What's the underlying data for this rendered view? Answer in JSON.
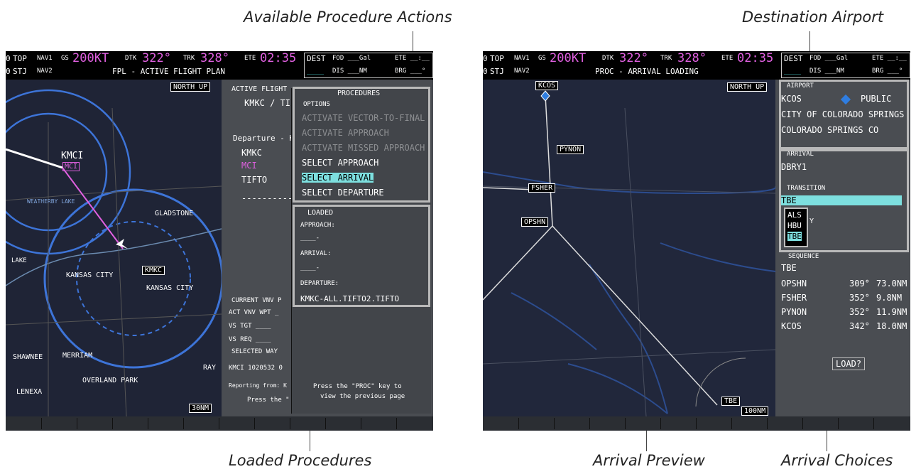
{
  "callouts": {
    "available_actions": "Available Procedure Actions",
    "destination_airport": "Destination Airport",
    "loaded_procedures": "Loaded Procedures",
    "arrival_preview": "Arrival Preview",
    "arrival_choices": "Arrival Choices"
  },
  "left": {
    "nav": {
      "top": "TOP",
      "stj": "STJ",
      "nav1": "NAV1",
      "nav2": "NAV2",
      "gs_label": "GS",
      "gs_value": "200KT",
      "dtk_label": "DTK",
      "dtk_value": "322°",
      "trk_label": "TRK",
      "trk_value": "328°",
      "ete_label": "ETE",
      "ete_value": "02:35",
      "dest": "DEST",
      "fod": "FOD ___Gal",
      "ete2": "ETE __:__",
      "dis": "DIS ___NM",
      "brg": "BRG ___°",
      "dashes": "____",
      "zero1": "0",
      "zero2": "0"
    },
    "page_title": "FPL - ACTIVE FLIGHT PLAN",
    "north_up": "NORTH UP",
    "range": "30NM",
    "map_labels": {
      "kmci": "KMCI",
      "mci": "MCI",
      "kmkc": "KMKC",
      "kansas_city": "KANSAS CITY",
      "kansas_city2": "KANSAS CITY",
      "gladstone": "GLADSTONE",
      "shawnee": "SHAWNEE",
      "merriam": "MERRIAM",
      "overland_park": "OVERLAND PARK",
      "lenexa": "LENEXA",
      "weatherby": "WEATHERBY LAKE",
      "rays": "RAY",
      "lake": "LAKE"
    },
    "fpl": {
      "active_flight": "ACTIVE FLIGHT",
      "route": "KMKC / TI",
      "departure": "Departure - K",
      "wp1": "KMKC",
      "wp2": "MCI",
      "wp3": "TIFTO",
      "dashes": "------------",
      "vnv_header": "CURRENT VNV P",
      "act_vnv": "ACT VNV WPT _",
      "vs_tgt": "VS TGT ____",
      "vs_req": "VS REQ ____",
      "selected": "SELECTED WAY",
      "kmci_coord": "KMCI 1020532 0",
      "reporting": "Reporting from: K",
      "press": "Press the \""
    },
    "procedures": {
      "header": "PROCEDURES",
      "options": "OPTIONS",
      "items": [
        {
          "label": "ACTIVATE VECTOR-TO-FINAL",
          "enabled": false
        },
        {
          "label": "ACTIVATE APPROACH",
          "enabled": false
        },
        {
          "label": "ACTIVATE MISSED APPROACH",
          "enabled": false
        },
        {
          "label": "SELECT APPROACH",
          "enabled": true
        },
        {
          "label": "SELECT ARRIVAL",
          "enabled": true,
          "selected": true
        },
        {
          "label": "SELECT DEPARTURE",
          "enabled": true
        }
      ]
    },
    "loaded": {
      "header": "LOADED",
      "approach_label": "APPROACH:",
      "approach_value": "____-",
      "arrival_label": "ARRIVAL:",
      "arrival_value": "____-",
      "departure_label": "DEPARTURE:",
      "departure_value": "KMKC-ALL.TIFTO2.TIFTO",
      "hint_line1": "Press the \"PROC\" key to",
      "hint_line2": "view the previous page"
    }
  },
  "right": {
    "nav": {
      "top": "TOP",
      "stj": "STJ",
      "nav1": "NAV1",
      "nav2": "NAV2",
      "gs_label": "GS",
      "gs_value": "200KT",
      "dtk_label": "DTK",
      "dtk_value": "322°",
      "trk_label": "TRK",
      "trk_value": "328°",
      "ete_label": "ETE",
      "ete_value": "02:35",
      "dest": "DEST",
      "fod": "FOD ___Gal",
      "ete2": "ETE __:__",
      "dis": "DIS ___NM",
      "brg": "BRG ___°",
      "dashes": "____",
      "zero1": "0",
      "zero2": "0"
    },
    "page_title": "PROC - ARRIVAL LOADING",
    "north_up": "NORTH UP",
    "range": "100NM",
    "waypoints": {
      "kcos": "KCOS",
      "pynon": "PYNON",
      "fsher": "FSHER",
      "opshn": "OPSHN",
      "tbe": "TBE"
    },
    "airport": {
      "header": "AIRPORT",
      "ident": "KCOS",
      "type": "PUBLIC",
      "name": "CITY OF COLORADO SPRINGS",
      "city": "COLORADO SPRINGS CO"
    },
    "arrival": {
      "header": "ARRIVAL",
      "value": "DBRY1",
      "transition_header": "TRANSITION",
      "transition_value": "TBE",
      "choices": [
        "ALS",
        "HBU",
        "TBE"
      ],
      "runway_partial": "Y"
    },
    "sequence": {
      "header": "SEQUENCE",
      "first": "TBE",
      "rows": [
        {
          "wpt": "OPSHN",
          "dtk": "309°",
          "dis": "73.0NM"
        },
        {
          "wpt": "FSHER",
          "dtk": "352°",
          "dis": "9.8NM"
        },
        {
          "wpt": "PYNON",
          "dtk": "352°",
          "dis": "11.9NM"
        },
        {
          "wpt": "KCOS",
          "dtk": "342°",
          "dis": "18.0NM"
        }
      ]
    },
    "load_button": "LOAD?"
  },
  "colors": {
    "cyan": "#4de0e0",
    "magenta": "#e060e0",
    "frame": "#b9b9b9"
  }
}
